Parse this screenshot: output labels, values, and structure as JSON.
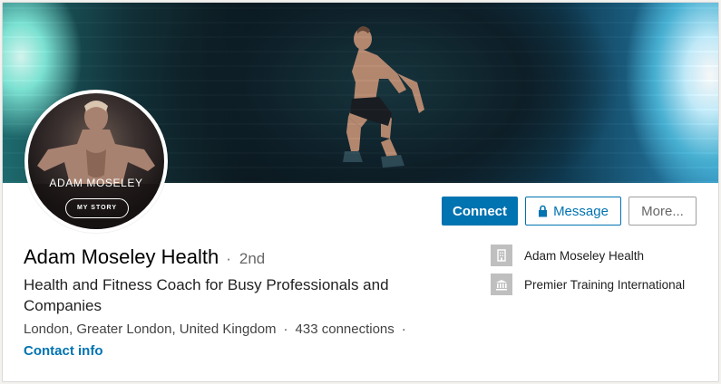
{
  "avatar": {
    "overlay_name": "ADAM MOSELEY",
    "story_label": "MY STORY"
  },
  "actions": {
    "connect": "Connect",
    "message": "Message",
    "more": "More..."
  },
  "profile": {
    "name": "Adam Moseley Health",
    "separator": "·",
    "degree": "2nd",
    "headline": "Health and Fitness Coach for Busy Professionals and Companies",
    "location": "London, Greater London, United Kingdom",
    "connections": "433 connections",
    "contact_info": "Contact info"
  },
  "organizations": [
    {
      "name": "Adam Moseley Health",
      "icon": "building-icon"
    },
    {
      "name": "Premier Training International",
      "icon": "school-icon"
    }
  ],
  "colors": {
    "accent": "#0073b1",
    "icon_bg": "#bfbfbf"
  }
}
